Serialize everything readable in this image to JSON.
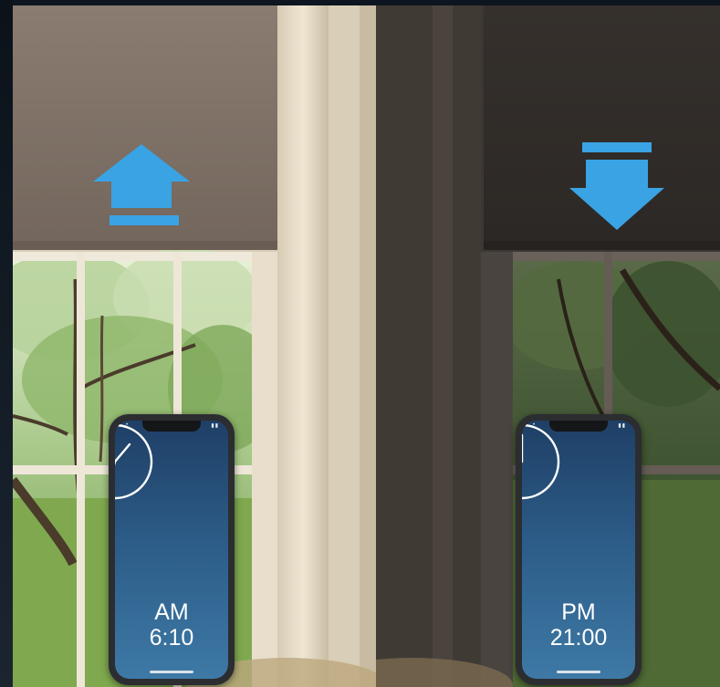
{
  "colors": {
    "arrow": "#3aa3e4",
    "shade_day": "#7a6c62",
    "shade_night": "#2e2a27",
    "screen": "#2b5b86"
  },
  "icons": {
    "raise": "arrow-up-icon",
    "lower": "arrow-down-icon",
    "clock": "clock-icon"
  },
  "morning": {
    "period": "AM",
    "time": "6:10",
    "blind_state": "raised"
  },
  "evening": {
    "period": "PM",
    "time": "21:00",
    "blind_state": "lowered"
  }
}
